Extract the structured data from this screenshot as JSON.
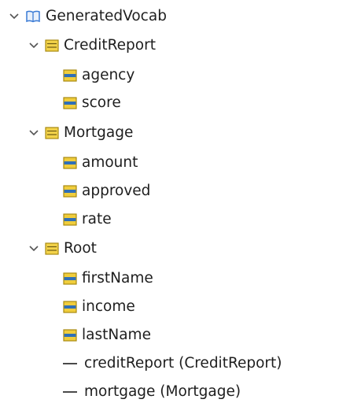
{
  "tree": {
    "root": {
      "label": "GeneratedVocab",
      "icon": "vocabulary-book-icon",
      "expanded": true
    },
    "groups": [
      {
        "label": "CreditReport",
        "icon": "type-folder-icon",
        "expanded": true,
        "children": [
          {
            "label": "agency",
            "icon": "attribute-icon"
          },
          {
            "label": "score",
            "icon": "attribute-icon"
          }
        ]
      },
      {
        "label": "Mortgage",
        "icon": "type-folder-icon",
        "expanded": true,
        "children": [
          {
            "label": "amount",
            "icon": "attribute-icon"
          },
          {
            "label": "approved",
            "icon": "attribute-icon"
          },
          {
            "label": "rate",
            "icon": "attribute-icon"
          }
        ]
      },
      {
        "label": "Root",
        "icon": "type-folder-icon",
        "expanded": true,
        "children": [
          {
            "label": "firstName",
            "icon": "attribute-icon"
          },
          {
            "label": "income",
            "icon": "attribute-icon"
          },
          {
            "label": "lastName",
            "icon": "attribute-icon"
          },
          {
            "label": "creditReport (CreditReport)",
            "icon": "reference-dash-icon"
          },
          {
            "label": "mortgage (Mortgage)",
            "icon": "reference-dash-icon"
          }
        ]
      }
    ]
  },
  "colors": {
    "folder_fill": "#f3d34a",
    "folder_stroke": "#a88a12",
    "attribute_fill": "#f0cd3c",
    "attribute_bar": "#2f6fb8",
    "book_blue": "#3a7bd5",
    "chevron": "#555555"
  }
}
